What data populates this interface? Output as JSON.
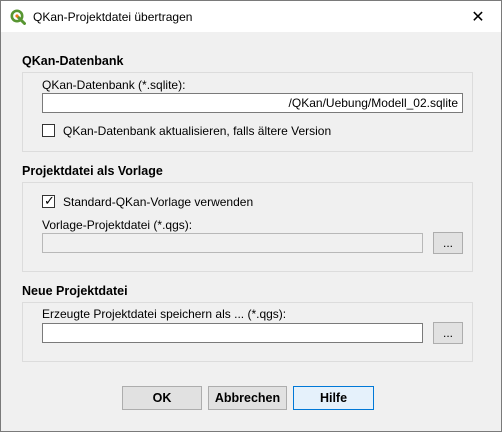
{
  "window": {
    "title": "QKan-Projektdatei übertragen",
    "app_icon": "qgis-logo-icon",
    "close_glyph": "✕"
  },
  "group_db": {
    "title": "QKan-Datenbank",
    "field_label": "QKan-Datenbank (*.sqlite):",
    "field_value": "/QKan/Uebung/Modell_02.sqlite",
    "checkbox_label": "QKan-Datenbank aktualisieren, falls ältere Version",
    "checkbox_checked": false
  },
  "group_template": {
    "title": "Projektdatei als Vorlage",
    "checkbox_label": "Standard-QKan-Vorlage verwenden",
    "checkbox_checked": true,
    "field_label": "Vorlage-Projektdatei (*.qgs):",
    "field_value": "",
    "browse_label": "..."
  },
  "group_new": {
    "title": "Neue Projektdatei",
    "field_label": "Erzeugte Projektdatei speichern als ... (*.qgs):",
    "field_value": "",
    "browse_label": "..."
  },
  "buttons": {
    "ok": "OK",
    "cancel": "Abbrechen",
    "help": "Hilfe"
  },
  "colors": {
    "accent": "#0078d7",
    "qgis_green": "#589632",
    "qgis_yellow": "#ee7913"
  }
}
